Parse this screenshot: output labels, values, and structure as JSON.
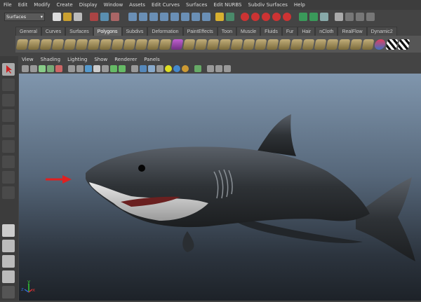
{
  "menubar": {
    "items": [
      "File",
      "Edit",
      "Modify",
      "Create",
      "Display",
      "Window",
      "Assets",
      "Edit Curves",
      "Surfaces",
      "Edit NURBS",
      "Subdiv Surfaces",
      "Help"
    ]
  },
  "statusline": {
    "mode": "Surfaces"
  },
  "shelf": {
    "tabs": [
      "General",
      "Curves",
      "Surfaces",
      "Polygons",
      "Subdivs",
      "Deformation",
      "PaintEffects",
      "Toon",
      "Muscle",
      "Fluids",
      "Fur",
      "Hair",
      "nCloth",
      "RealFlow",
      "Dynamic2"
    ],
    "active": "Polygons"
  },
  "panel": {
    "menus": [
      "View",
      "Shading",
      "Lighting",
      "Show",
      "Renderer",
      "Panels"
    ]
  },
  "viewport": {
    "annotation": "red-arrow",
    "axis": {
      "x": "x",
      "y": "y",
      "z": "z"
    }
  },
  "colors": {
    "arrow": "#e02020",
    "viewport_top": "#8096ad",
    "viewport_bottom": "#1d2228"
  }
}
